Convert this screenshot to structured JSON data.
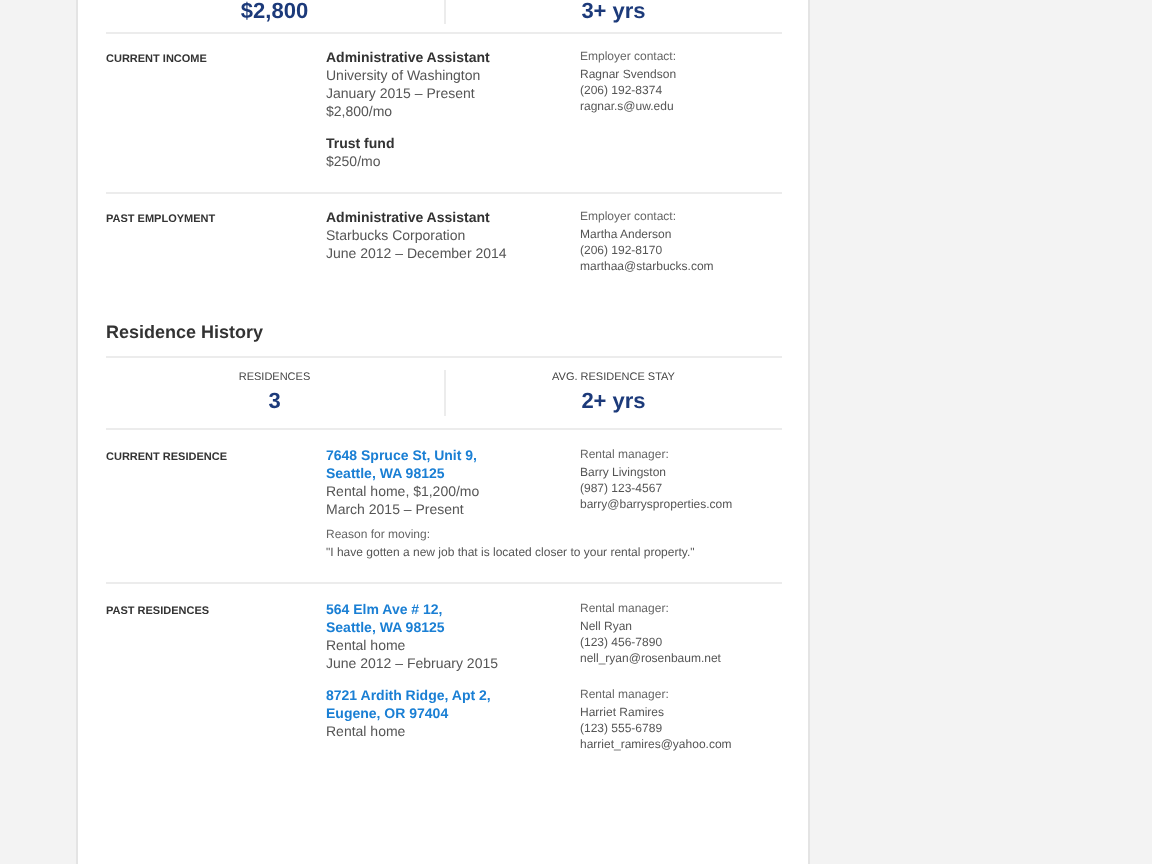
{
  "top_stats": [
    {
      "value": "$2,800"
    },
    {
      "value": "3+ yrs"
    }
  ],
  "employment_sections": [
    {
      "label": "CURRENT INCOME",
      "entries": [
        {
          "title": "Administrative Assistant",
          "lines": [
            "University of Washington",
            "January 2015 – Present",
            "$2,800/mo"
          ],
          "contact": {
            "heading": "Employer contact:",
            "lines": [
              "Ragnar Svendson",
              "(206) 192-8374",
              "ragnar.s@uw.edu"
            ]
          }
        },
        {
          "title": "Trust fund",
          "lines": [
            "$250/mo"
          ]
        }
      ]
    },
    {
      "label": "PAST EMPLOYMENT",
      "entries": [
        {
          "title": "Administrative Assistant",
          "lines": [
            "Starbucks Corporation",
            "June 2012 – December 2014"
          ],
          "contact": {
            "heading": "Employer contact:",
            "lines": [
              "Martha Anderson",
              "(206) 192-8170",
              "marthaa@starbucks.com"
            ]
          }
        }
      ]
    }
  ],
  "residence_history": {
    "title": "Residence History",
    "stats": [
      {
        "label": "RESIDENCES",
        "value": "3"
      },
      {
        "label": "AVG. RESIDENCE STAY",
        "value": "2+ yrs"
      }
    ],
    "sections": [
      {
        "label": "CURRENT RESIDENCE",
        "entries": [
          {
            "address": [
              "7648 Spruce St, Unit 9,",
              "Seattle, WA 98125"
            ],
            "lines": [
              "Rental home, $1,200/mo",
              "March 2015 – Present"
            ],
            "manager": {
              "heading": "Rental manager:",
              "lines": [
                "Barry Livingston",
                "(987) 123-4567",
                "barry@barrysproperties.com"
              ]
            },
            "reason": {
              "heading": "Reason for moving:",
              "text": "\"I have gotten a new job that is located closer to your rental property.\""
            }
          }
        ]
      },
      {
        "label": "PAST RESIDENCES",
        "entries": [
          {
            "address": [
              "564 Elm Ave # 12,",
              "Seattle, WA 98125"
            ],
            "lines": [
              "Rental home",
              "June 2012 – February 2015"
            ],
            "manager": {
              "heading": "Rental manager:",
              "lines": [
                "Nell Ryan",
                "(123) 456-7890",
                "nell_ryan@rosenbaum.net"
              ]
            }
          },
          {
            "address": [
              "8721 Ardith Ridge, Apt 2,",
              "Eugene, OR 97404"
            ],
            "lines": [
              "Rental home"
            ],
            "manager": {
              "heading": "Rental manager:",
              "lines": [
                "Harriet Ramires",
                "(123) 555-6789",
                "harriet_ramires@yahoo.com"
              ]
            }
          }
        ]
      }
    ]
  }
}
